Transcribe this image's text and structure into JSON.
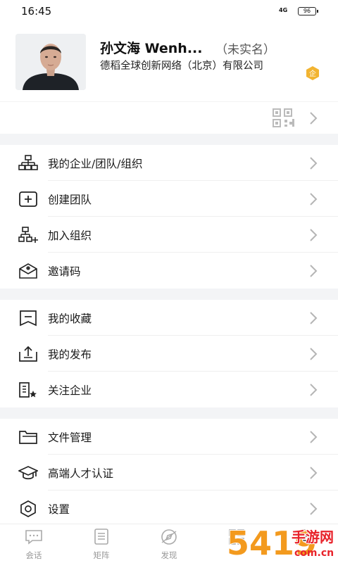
{
  "status_bar": {
    "time": "16:45",
    "signal": "4G",
    "battery": "96"
  },
  "profile": {
    "name": "孙文海 Wenh...",
    "verification": "（未实名）",
    "company": "德稻全球创新网络（北京）有限公司",
    "badge": "企"
  },
  "menu_groups": [
    [
      {
        "label": "我的企业/团队/组织",
        "icon": "org-chart-icon"
      },
      {
        "label": "创建团队",
        "icon": "plus-square-icon"
      },
      {
        "label": "加入组织",
        "icon": "org-add-icon"
      },
      {
        "label": "邀请码",
        "icon": "invite-mail-icon"
      }
    ],
    [
      {
        "label": "我的收藏",
        "icon": "bookmark-icon"
      },
      {
        "label": "我的发布",
        "icon": "upload-tray-icon"
      },
      {
        "label": "关注企业",
        "icon": "building-star-icon"
      }
    ],
    [
      {
        "label": "文件管理",
        "icon": "folder-icon"
      },
      {
        "label": "高端人才认证",
        "icon": "graduation-cap-icon"
      },
      {
        "label": "设置",
        "icon": "gear-icon"
      }
    ]
  ],
  "tabs": [
    {
      "label": "会话",
      "icon": "chat-bubble-icon"
    },
    {
      "label": "矩阵",
      "icon": "document-list-icon"
    },
    {
      "label": "发现",
      "icon": "compass-icon"
    },
    {
      "label": "",
      "icon": "grid-icon"
    },
    {
      "label": "",
      "icon": "profile-icon"
    }
  ],
  "watermark": {
    "number": "5419",
    "site_text": "手游网",
    "domain_text": "com.cn"
  }
}
